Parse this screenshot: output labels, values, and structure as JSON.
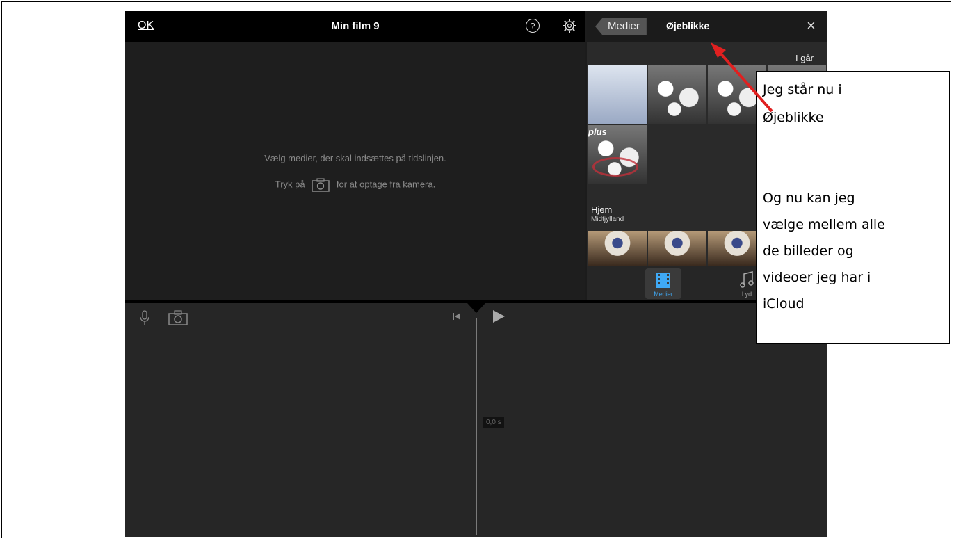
{
  "app": {
    "ok_label": "OK",
    "title": "Min film 9",
    "help_icon": "?"
  },
  "preview": {
    "hint_line1": "Vælg medier, der skal indsættes på tidslinjen.",
    "hint_line2_before": "Tryk på",
    "hint_line2_after": "for at optage fra kamera."
  },
  "browser": {
    "back_label": "Medier",
    "title": "Øjeblikke",
    "close_icon": "×",
    "section_label": "I går",
    "thumb_overlay_text": "plus",
    "place_name": "Hjem",
    "place_region": "Midtjylland",
    "tabs": [
      {
        "label": "Medier",
        "icon": "film-icon",
        "selected": true
      },
      {
        "label": "Lyd",
        "icon": "music-note-icon",
        "selected": false
      }
    ]
  },
  "timeline": {
    "timecode": "0,0 s"
  },
  "callout": {
    "line1": "Jeg står nu i",
    "line2": "Øjeblikke",
    "line3": "Og nu kan jeg",
    "line4": "vælge mellem alle",
    "line5": "de billeder og",
    "line6": "videoer jeg har i",
    "line7": "iCloud"
  },
  "colors": {
    "accent_blue": "#3fa9f5",
    "arrow_red": "#e02020",
    "panel_dark": "#1c1c1c"
  }
}
